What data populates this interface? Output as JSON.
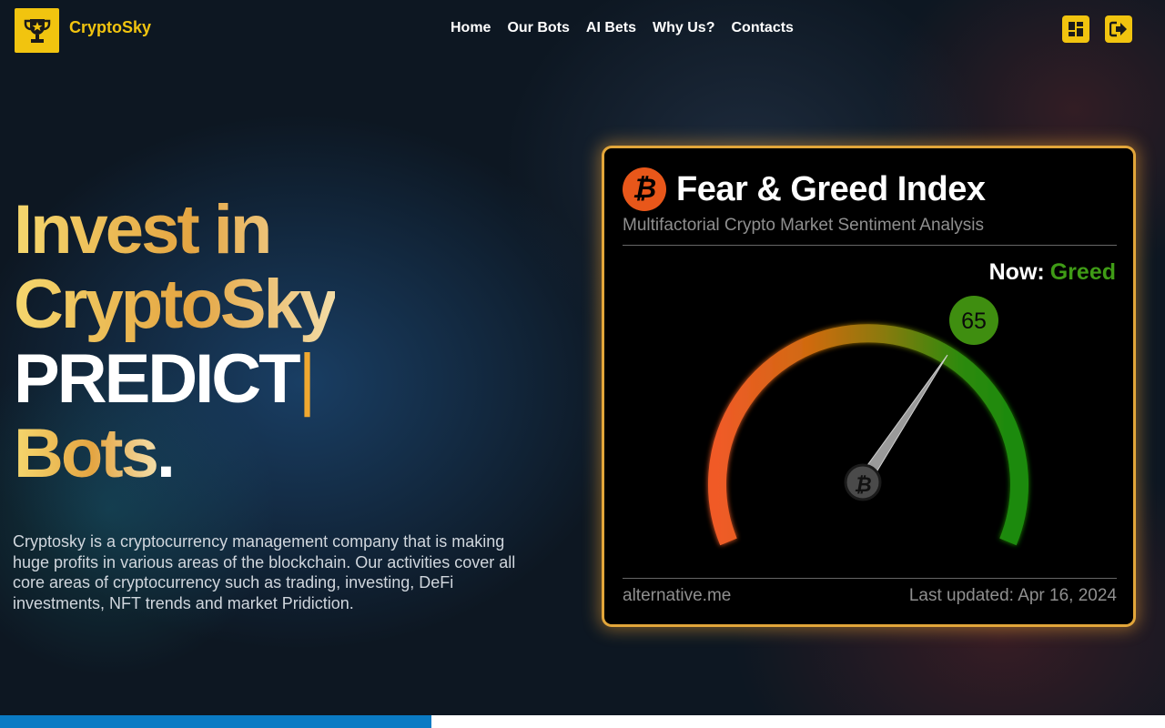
{
  "header": {
    "brand": "CryptoSky",
    "nav": [
      "Home",
      "Our Bots",
      "AI Bets",
      "Why Us?",
      "Contacts"
    ],
    "icons": [
      "trophy-icon",
      "dashboard-icon",
      "logout-icon"
    ],
    "accent_color": "#f1c40f"
  },
  "hero": {
    "line1": "Invest in",
    "line2": "CryptoSky",
    "line3": "PREDICT",
    "cursor": "|",
    "line4": "Bots",
    "period": ".",
    "description": "Cryptosky is a cryptocurrency management company that is making huge profits in various areas of the blockchain. Our activities cover all core areas of cryptocurrency such as trading, investing, DeFi investments, NFT trends and market Pridiction."
  },
  "widget": {
    "title": "Fear & Greed Index",
    "subtitle": "Multifactorial Crypto Market Sentiment Analysis",
    "now_label": "Now:",
    "now_value": "Greed",
    "index_value": 65,
    "index_scale": [
      0,
      100
    ],
    "source": "alternative.me",
    "updated": "Last updated: Apr 16, 2024",
    "greed_color": "#3f9c16"
  }
}
